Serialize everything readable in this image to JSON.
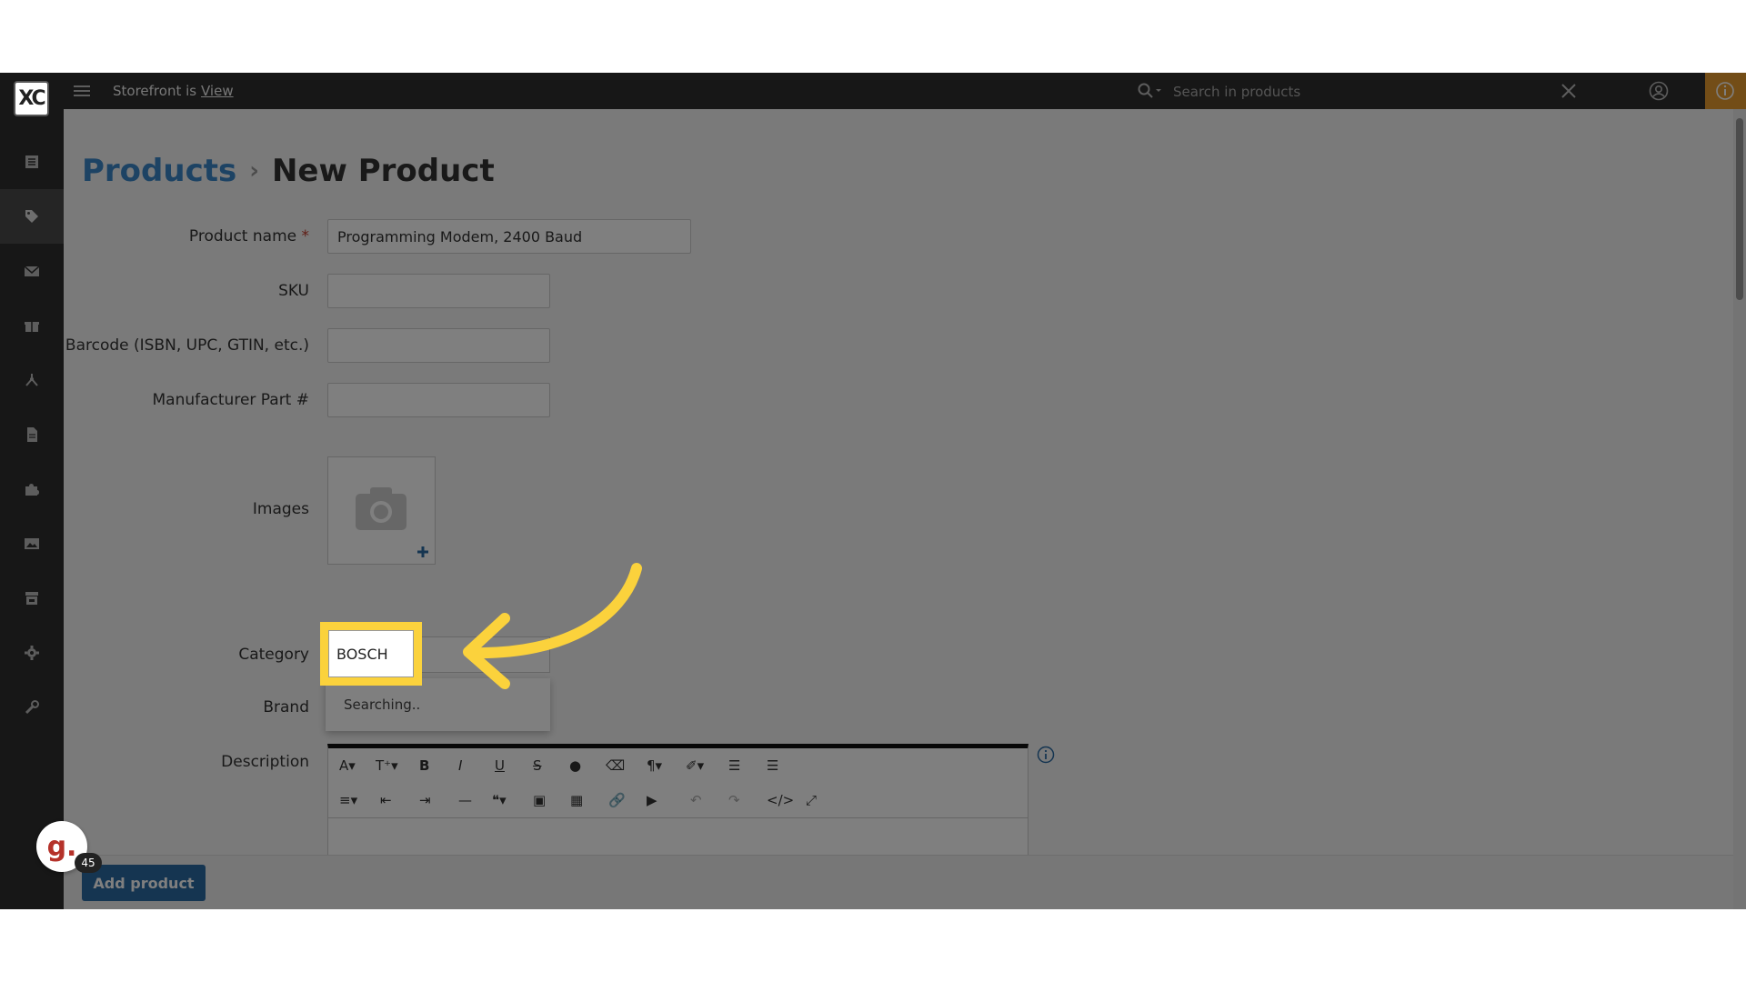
{
  "topbar": {
    "storefront_text": "Storefront is",
    "view_link": "View",
    "search_placeholder": "Search in products"
  },
  "logo": {
    "text": "XC"
  },
  "sidebar": {
    "items": [
      {
        "icon": "list-icon"
      },
      {
        "icon": "tag-icon",
        "active": true
      },
      {
        "icon": "envelope-icon"
      },
      {
        "icon": "gift-icon"
      },
      {
        "icon": "network-icon"
      },
      {
        "icon": "file-icon"
      },
      {
        "icon": "puzzle-icon"
      },
      {
        "icon": "image-icon"
      },
      {
        "icon": "store-icon"
      },
      {
        "icon": "gear-icon"
      },
      {
        "icon": "wrench-icon"
      }
    ]
  },
  "breadcrumb": {
    "parent": "Products",
    "separator": "›",
    "current": "New Product"
  },
  "form": {
    "product_name": {
      "label": "Product name",
      "required_mark": "*",
      "value": "Programming Modem, 2400 Baud"
    },
    "sku": {
      "label": "SKU",
      "value": ""
    },
    "barcode": {
      "label": "Barcode (ISBN, UPC, GTIN, etc.)",
      "value": ""
    },
    "mpn": {
      "label": "Manufacturer Part #",
      "value": ""
    },
    "images": {
      "label": "Images"
    },
    "category": {
      "label": "Category",
      "value": "BOSCH",
      "dropdown_text": "Searching.."
    },
    "brand": {
      "label": "Brand"
    },
    "description": {
      "label": "Description"
    }
  },
  "footer": {
    "add_product_label": "Add product"
  },
  "widget": {
    "avatar_letter": "g.",
    "badge_count": "45"
  },
  "colors": {
    "accent": "#2b6aa3",
    "highlight": "#fbd23c",
    "topbar": "#2e2e2e",
    "info_tab": "#e79a2f"
  }
}
